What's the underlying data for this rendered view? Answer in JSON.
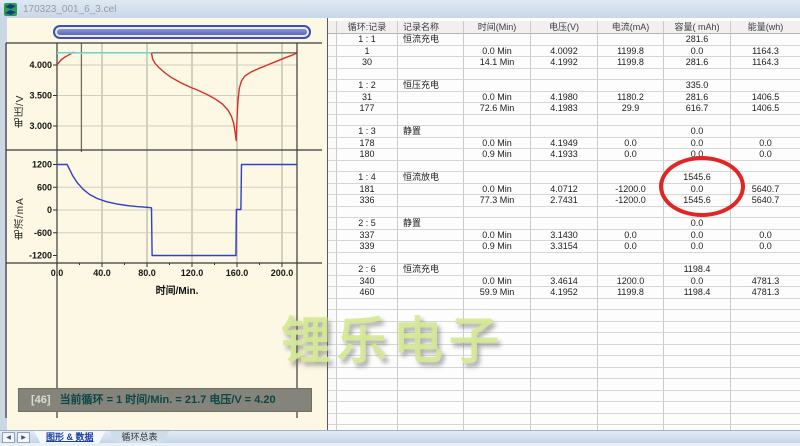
{
  "window": {
    "title": "170323_001_6_3.cel"
  },
  "colors": {
    "chart_bg": "#fcf8e3",
    "voltage_curve": "#d83028",
    "cv_segment": "#7fe3e0",
    "current_curve": "#2f3fd0",
    "annotation": "#df1411",
    "watermark": "#d5e894",
    "status_bg": "#84847a",
    "status_text": "#0d4646"
  },
  "watermark": "锂乐电子",
  "status_bar": {
    "prefix": "[46]",
    "text": "当前循环 = 1  时间/Min. = 21.7 电压/V = 4.20"
  },
  "tabs": {
    "graph_data": "图形 & 数据",
    "cycle_summary": "循环总表",
    "prev": "◀",
    "next": "▶"
  },
  "chart_data": [
    {
      "type": "line",
      "ylabel": "电压/V",
      "xlabel": "时间/Min.",
      "x_range": [
        0,
        213
      ],
      "xticks": [
        0,
        40,
        80,
        120,
        160,
        200
      ],
      "xtick_labels": [
        "0.0",
        "40.0",
        "80.0",
        "120.0",
        "160.0",
        "200.0"
      ],
      "yticks": [
        4.0,
        3.5,
        3.0
      ],
      "ytick_labels": [
        "4.000",
        "3.500",
        "3.000"
      ],
      "ylim": [
        2.6,
        4.36
      ],
      "grid": true,
      "cursor": {
        "time_min": 21.7,
        "voltage_v": 4.2
      },
      "series": [
        {
          "name": "voltage-cc-charge",
          "color": "#d83028",
          "points": [
            [
              0,
              4.005
            ],
            [
              2,
              4.05
            ],
            [
              4,
              4.09
            ],
            [
              7,
              4.13
            ],
            [
              10,
              4.16
            ],
            [
              12,
              4.18
            ],
            [
              14,
              4.2
            ],
            [
              15.5,
              4.21
            ]
          ]
        },
        {
          "name": "voltage-cv-hold",
          "color": "#7fe3e0",
          "points": [
            [
              0,
              4.197
            ],
            [
              84,
              4.197
            ]
          ]
        },
        {
          "name": "voltage-discharge-recharge",
          "color": "#d83028",
          "points": [
            [
              84,
              4.195
            ],
            [
              85,
              4.1
            ],
            [
              87,
              4.03
            ],
            [
              91,
              3.95
            ],
            [
              96,
              3.87
            ],
            [
              102,
              3.79
            ],
            [
              110,
              3.71
            ],
            [
              118,
              3.64
            ],
            [
              126,
              3.58
            ],
            [
              134,
              3.51
            ],
            [
              141,
              3.44
            ],
            [
              147,
              3.36
            ],
            [
              152,
              3.26
            ],
            [
              155,
              3.16
            ],
            [
              157,
              3.05
            ],
            [
              158.5,
              2.88
            ],
            [
              159.3,
              2.76
            ],
            [
              160,
              3.1
            ],
            [
              160.8,
              3.4
            ],
            [
              162,
              3.62
            ],
            [
              164,
              3.74
            ],
            [
              167,
              3.82
            ],
            [
              172,
              3.88
            ],
            [
              179,
              3.94
            ],
            [
              187,
              4.0
            ],
            [
              195,
              4.06
            ],
            [
              203,
              4.12
            ],
            [
              209,
              4.16
            ],
            [
              213,
              4.195
            ]
          ]
        }
      ]
    },
    {
      "type": "line",
      "ylabel": "电流/mA",
      "yticks": [
        1200,
        600,
        0,
        -600,
        -1200
      ],
      "ytick_labels": [
        "1200",
        "600",
        "0",
        "-600",
        "-1200"
      ],
      "ylim": [
        -1400,
        1400
      ],
      "grid": true,
      "series": [
        {
          "name": "current",
          "color": "#2f3fd0",
          "points": [
            [
              0,
              1200
            ],
            [
              9,
              1200
            ],
            [
              11,
              1080
            ],
            [
              14,
              900
            ],
            [
              18,
              720
            ],
            [
              23,
              550
            ],
            [
              29,
              410
            ],
            [
              36,
              300
            ],
            [
              44,
              220
            ],
            [
              53,
              160
            ],
            [
              62,
              118
            ],
            [
              71,
              90
            ],
            [
              80,
              70
            ],
            [
              84,
              58
            ],
            [
              84.5,
              -1200
            ],
            [
              159,
              -1200
            ],
            [
              159.5,
              12
            ],
            [
              163.5,
              12
            ],
            [
              164,
              1200
            ],
            [
              213,
              1200
            ]
          ]
        }
      ]
    }
  ],
  "table": {
    "headers": [
      "循环:记录",
      "记录名称",
      "时间(Min)",
      "电压(V)",
      "电流(mA)",
      "容量( mAh)",
      "能量(wh)"
    ],
    "rows": [
      [
        "1 : 1",
        "恒流充电",
        "",
        "",
        "",
        "281.6",
        ""
      ],
      [
        "1",
        "",
        "0.0 Min",
        "4.0092",
        "1199.8",
        "0.0",
        "1164.3"
      ],
      [
        "30",
        "",
        "14.1 Min",
        "4.1992",
        "1199.8",
        "281.6",
        "1164.3"
      ],
      [
        "",
        "",
        "",
        "",
        "",
        "",
        ""
      ],
      [
        "1 : 2",
        "恒压充电",
        "",
        "",
        "",
        "335.0",
        ""
      ],
      [
        "31",
        "",
        "0.0 Min",
        "4.1980",
        "1180.2",
        "281.6",
        "1406.5"
      ],
      [
        "177",
        "",
        "72.6 Min",
        "4.1983",
        "29.9",
        "616.7",
        "1406.5"
      ],
      [
        "",
        "",
        "",
        "",
        "",
        "",
        ""
      ],
      [
        "1 : 3",
        "静置",
        "",
        "",
        "",
        "0.0",
        ""
      ],
      [
        "178",
        "",
        "0.0 Min",
        "4.1949",
        "0.0",
        "0.0",
        "0.0"
      ],
      [
        "180",
        "",
        "0.9 Min",
        "4.1933",
        "0.0",
        "0.0",
        "0.0"
      ],
      [
        "",
        "",
        "",
        "",
        "",
        "",
        ""
      ],
      [
        "1 : 4",
        "恒流放电",
        "",
        "",
        "",
        "1545.6",
        ""
      ],
      [
        "181",
        "",
        "0.0 Min",
        "4.0712",
        "-1200.0",
        "0.0",
        "5640.7"
      ],
      [
        "336",
        "",
        "77.3 Min",
        "2.7431",
        "-1200.0",
        "1545.6",
        "5640.7"
      ],
      [
        "",
        "",
        "",
        "",
        "",
        "",
        ""
      ],
      [
        "2 : 5",
        "静置",
        "",
        "",
        "",
        "0.0",
        ""
      ],
      [
        "337",
        "",
        "0.0 Min",
        "3.1430",
        "0.0",
        "0.0",
        "0.0"
      ],
      [
        "339",
        "",
        "0.9 Min",
        "3.3154",
        "0.0",
        "0.0",
        "0.0"
      ],
      [
        "",
        "",
        "",
        "",
        "",
        "",
        ""
      ],
      [
        "2 : 6",
        "恒流充电",
        "",
        "",
        "",
        "1198.4",
        ""
      ],
      [
        "340",
        "",
        "0.0 Min",
        "3.4614",
        "1200.0",
        "0.0",
        "4781.3"
      ],
      [
        "460",
        "",
        "59.9 Min",
        "4.1952",
        "1199.8",
        "1198.4",
        "4781.3"
      ],
      [
        "",
        "",
        "",
        "",
        "",
        "",
        ""
      ],
      [
        "",
        "",
        "",
        "",
        "",
        "",
        ""
      ],
      [
        "",
        "",
        "",
        "",
        "",
        "",
        ""
      ],
      [
        "",
        "",
        "",
        "",
        "",
        "",
        ""
      ],
      [
        "",
        "",
        "",
        "",
        "",
        "",
        ""
      ],
      [
        "",
        "",
        "",
        "",
        "",
        "",
        ""
      ],
      [
        "",
        "",
        "",
        "",
        "",
        "",
        ""
      ],
      [
        "",
        "",
        "",
        "",
        "",
        "",
        ""
      ],
      [
        "",
        "",
        "",
        "",
        "",
        "",
        ""
      ],
      [
        "",
        "",
        "",
        "",
        "",
        "",
        ""
      ],
      [
        "",
        "",
        "",
        "",
        "",
        "",
        ""
      ],
      [
        "",
        "",
        "",
        "",
        "",
        "",
        ""
      ]
    ]
  },
  "annotation": {
    "shape": "ellipse",
    "color": "#df1411",
    "around": "容量 1545.6 放电段"
  }
}
